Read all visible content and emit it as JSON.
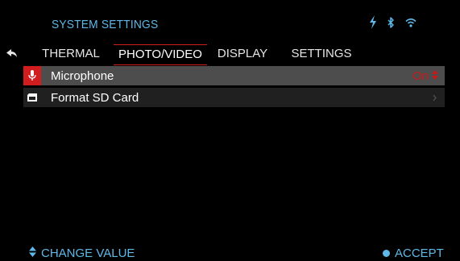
{
  "header": {
    "title": "SYSTEM SETTINGS",
    "status_icons": [
      "bolt-icon",
      "bluetooth-icon",
      "wifi-icon"
    ]
  },
  "tabs": [
    {
      "label": "THERMAL",
      "active": false
    },
    {
      "label": "PHOTO/VIDEO",
      "active": true
    },
    {
      "label": "DISPLAY",
      "active": false
    },
    {
      "label": "SETTINGS",
      "active": false
    }
  ],
  "menu": [
    {
      "label": "Microphone",
      "value": "On",
      "icon": "microphone-icon",
      "selected": true
    },
    {
      "label": "Format SD Card",
      "icon": "sd-card-icon",
      "selected": false
    }
  ],
  "footer": {
    "change_label": "CHANGE VALUE",
    "accept_label": "ACCEPT"
  },
  "colors": {
    "accent_blue": "#5fb8e8",
    "accent_red": "#d11d1d",
    "selected_row": "#4d4d4d",
    "row": "#202020",
    "background": "#000000"
  }
}
